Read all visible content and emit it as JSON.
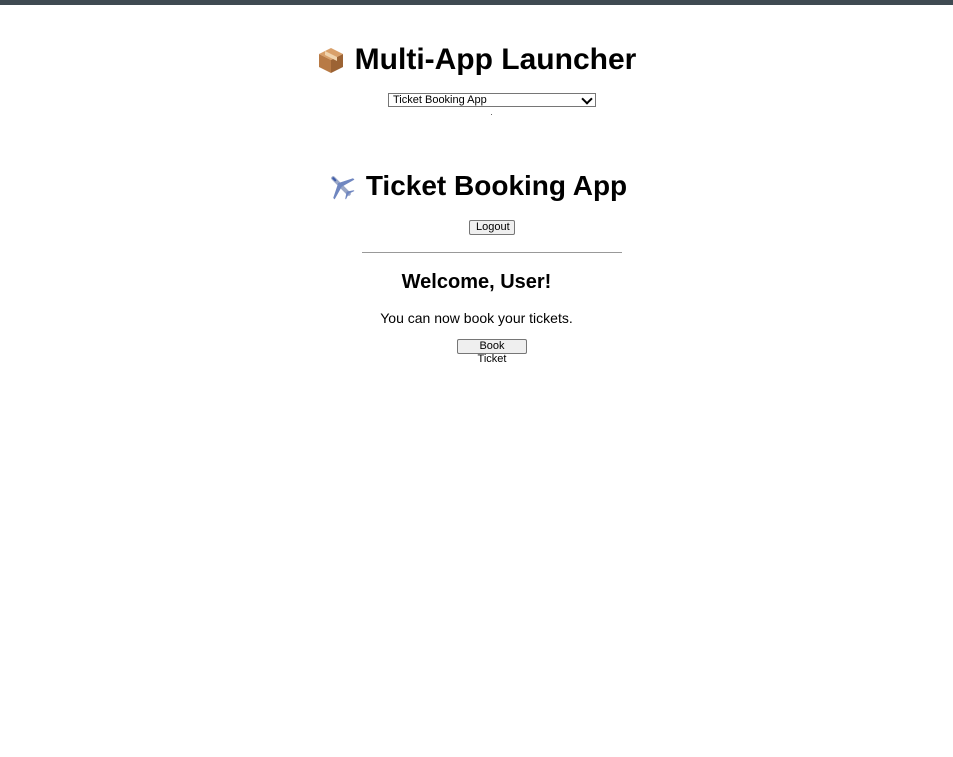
{
  "colors": {
    "top_strip": "#3f4a52",
    "background": "#ffffff",
    "divider": "#999999"
  },
  "launcher": {
    "icon": "package-icon",
    "title": "Multi-App Launcher",
    "select": {
      "selected": "Ticket Booking App"
    }
  },
  "app": {
    "icon": "airplane-icon",
    "title": "Ticket Booking App",
    "logout_label": "Logout"
  },
  "main": {
    "welcome": "Welcome, User!",
    "message": "You can now book your tickets.",
    "book_label": "Book Ticket"
  }
}
